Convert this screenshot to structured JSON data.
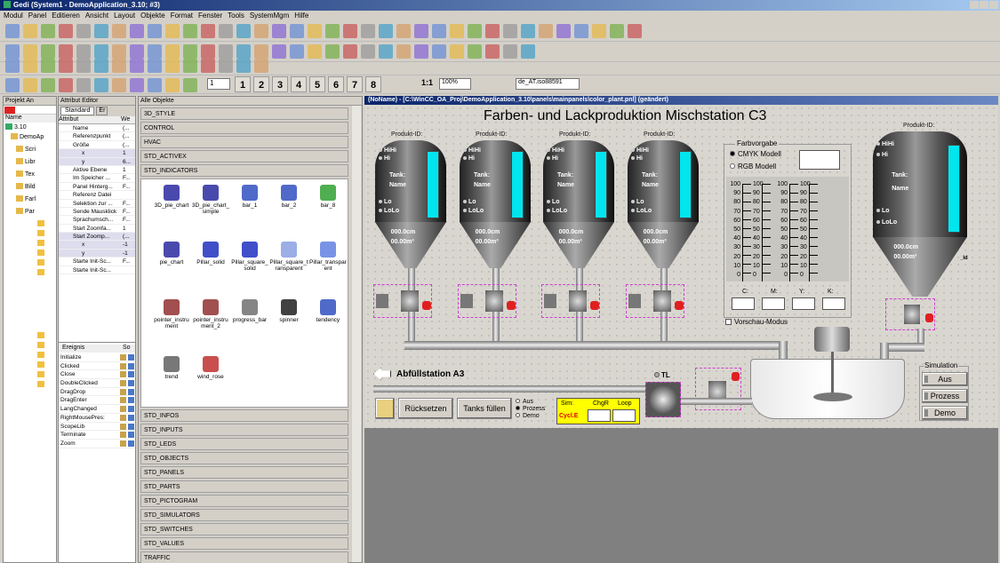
{
  "window": {
    "title": "Gedi (System1 - DemoApplication_3.10; #3)"
  },
  "menu": [
    "Modul",
    "Panel",
    "Editieren",
    "Ansicht",
    "Layout",
    "Objekte",
    "Format",
    "Fenster",
    "Tools",
    "SystemMgm",
    "Hilfe"
  ],
  "toolbar": {
    "numbers": [
      "1",
      "2",
      "3",
      "4",
      "5",
      "6",
      "7",
      "8"
    ],
    "zoom": "100%",
    "ratio": "1:1",
    "locale": "de_AT.iso88591",
    "layer": "1"
  },
  "project": {
    "title": "Projekt An",
    "version": "3.10",
    "nodes": [
      "DemoAp",
      "Scri",
      "Libr",
      "Tex",
      "Bild",
      "Farl",
      "Par"
    ]
  },
  "attr_editor": {
    "title": "Attribut Editor",
    "tab_standard": "Standard",
    "tab_extended": "Er",
    "col_attr": "Attribut",
    "col_val": "We",
    "rows": [
      {
        "k": "Name",
        "v": "(..."
      },
      {
        "k": "Referenzpunkt",
        "v": "(..."
      },
      {
        "k": "Größe",
        "v": "(..."
      },
      {
        "k": "x",
        "v": "1"
      },
      {
        "k": "y",
        "v": "6..."
      },
      {
        "k": "Aktive Ebene",
        "v": "1"
      },
      {
        "k": "Im Speicher ...",
        "v": "F..."
      },
      {
        "k": "Panel Hinterg...",
        "v": "F..."
      },
      {
        "k": "Referenz Datei",
        "v": ""
      },
      {
        "k": "Selektion zur ...",
        "v": "F..."
      },
      {
        "k": "Sende Mausklick",
        "v": "F..."
      },
      {
        "k": "Sprachumsch...",
        "v": "F..."
      },
      {
        "k": "Start Zoomfa...",
        "v": "1"
      },
      {
        "k": "Start Zoomp...",
        "v": "(..."
      },
      {
        "k": "x",
        "v": "-1"
      },
      {
        "k": "y",
        "v": "-1"
      },
      {
        "k": "Starte Init-Sc...",
        "v": "F..."
      },
      {
        "k": "Starte Init-Sc...",
        "v": ""
      }
    ],
    "events_title": "Ereignis",
    "events_col": "So",
    "events": [
      "Initialize",
      "Clicked",
      "Close",
      "DoubleClicked",
      "DragDrop",
      "DragEnter",
      "LangChanged",
      "RightMousePres:",
      "ScopeLib",
      "Terminate",
      "Zoom"
    ]
  },
  "objects": {
    "title": "Alle Objekte",
    "categories_top": [
      "3D_STYLE",
      "CONTROL",
      "HVAC",
      "STD_ACTIVEX",
      "STD_INDICATORS"
    ],
    "indicators": [
      "3D_pie_chart",
      "3D_pie_chart_simple",
      "bar_1",
      "bar_2",
      "bar_8",
      "pie_chart",
      "Pillar_solid",
      "Pillar_square_solid",
      "Pillar_square_transparent",
      "Pillar_transparent",
      "pointer_instrument",
      "pointer_instrument_2",
      "progress_bar",
      "spinner",
      "tendency",
      "trend",
      "wind_rose"
    ],
    "categories_bottom": [
      "STD_INFOS",
      "STD_INPUTS",
      "STD_LEDS",
      "STD_OBJECTS",
      "STD_PANELS",
      "STD_PARTS",
      "STD_PICTOGRAM",
      "STD_SIMULATORS",
      "STD_SWITCHES",
      "STD_VALUES",
      "TRAFFIC"
    ]
  },
  "hmi": {
    "window_title": "(NoName) - [C:\\WinCC_OA_Proj\\DemoApplication_3.10\\panels\\mainpanels\\color_plant.pnl] (geändert)",
    "heading": "Farben- und Lackproduktion  Mischstation C3",
    "product_label": "Produkt-ID:",
    "tank_hihi": "HiHi",
    "tank_hi": "Hi",
    "tank_name_1": "Tank:",
    "tank_name_2": "Name",
    "tank_lo": "Lo",
    "tank_lolo": "LoLo",
    "tank_level": "000.0cm",
    "tank_volume": "00.00m³",
    "color_title": "Farbvorgabe",
    "cmyk": "CMYK Modell",
    "rgb": "RGB Modell",
    "scale": [
      "100",
      "90",
      "80",
      "70",
      "60",
      "50",
      "40",
      "30",
      "20",
      "10",
      "0"
    ],
    "channels": [
      "C:",
      "M:",
      "Y:",
      "K:"
    ],
    "preview": "Vorschau-Modus",
    "fill_station": "Abfüllstation A3",
    "tl": "TL",
    "reset": "Rücksetzen",
    "fill_tanks": "Tanks füllen",
    "mode": [
      "Aus",
      "Prozess",
      "Demo"
    ],
    "sim_box": {
      "sim": "Sim:",
      "chgr": "ChgR",
      "loop": "Loop",
      "cycle": "Cycl.E"
    },
    "simulation": {
      "title": "Simulation",
      "buttons": [
        "Aus",
        "Prozess",
        "Demo"
      ]
    },
    "tag": "_Id"
  },
  "colors": {
    "level": "#00e5ee",
    "accent": "#0a246a",
    "valve_frame": "#d040d0",
    "sim_yellow": "#ffff00"
  }
}
